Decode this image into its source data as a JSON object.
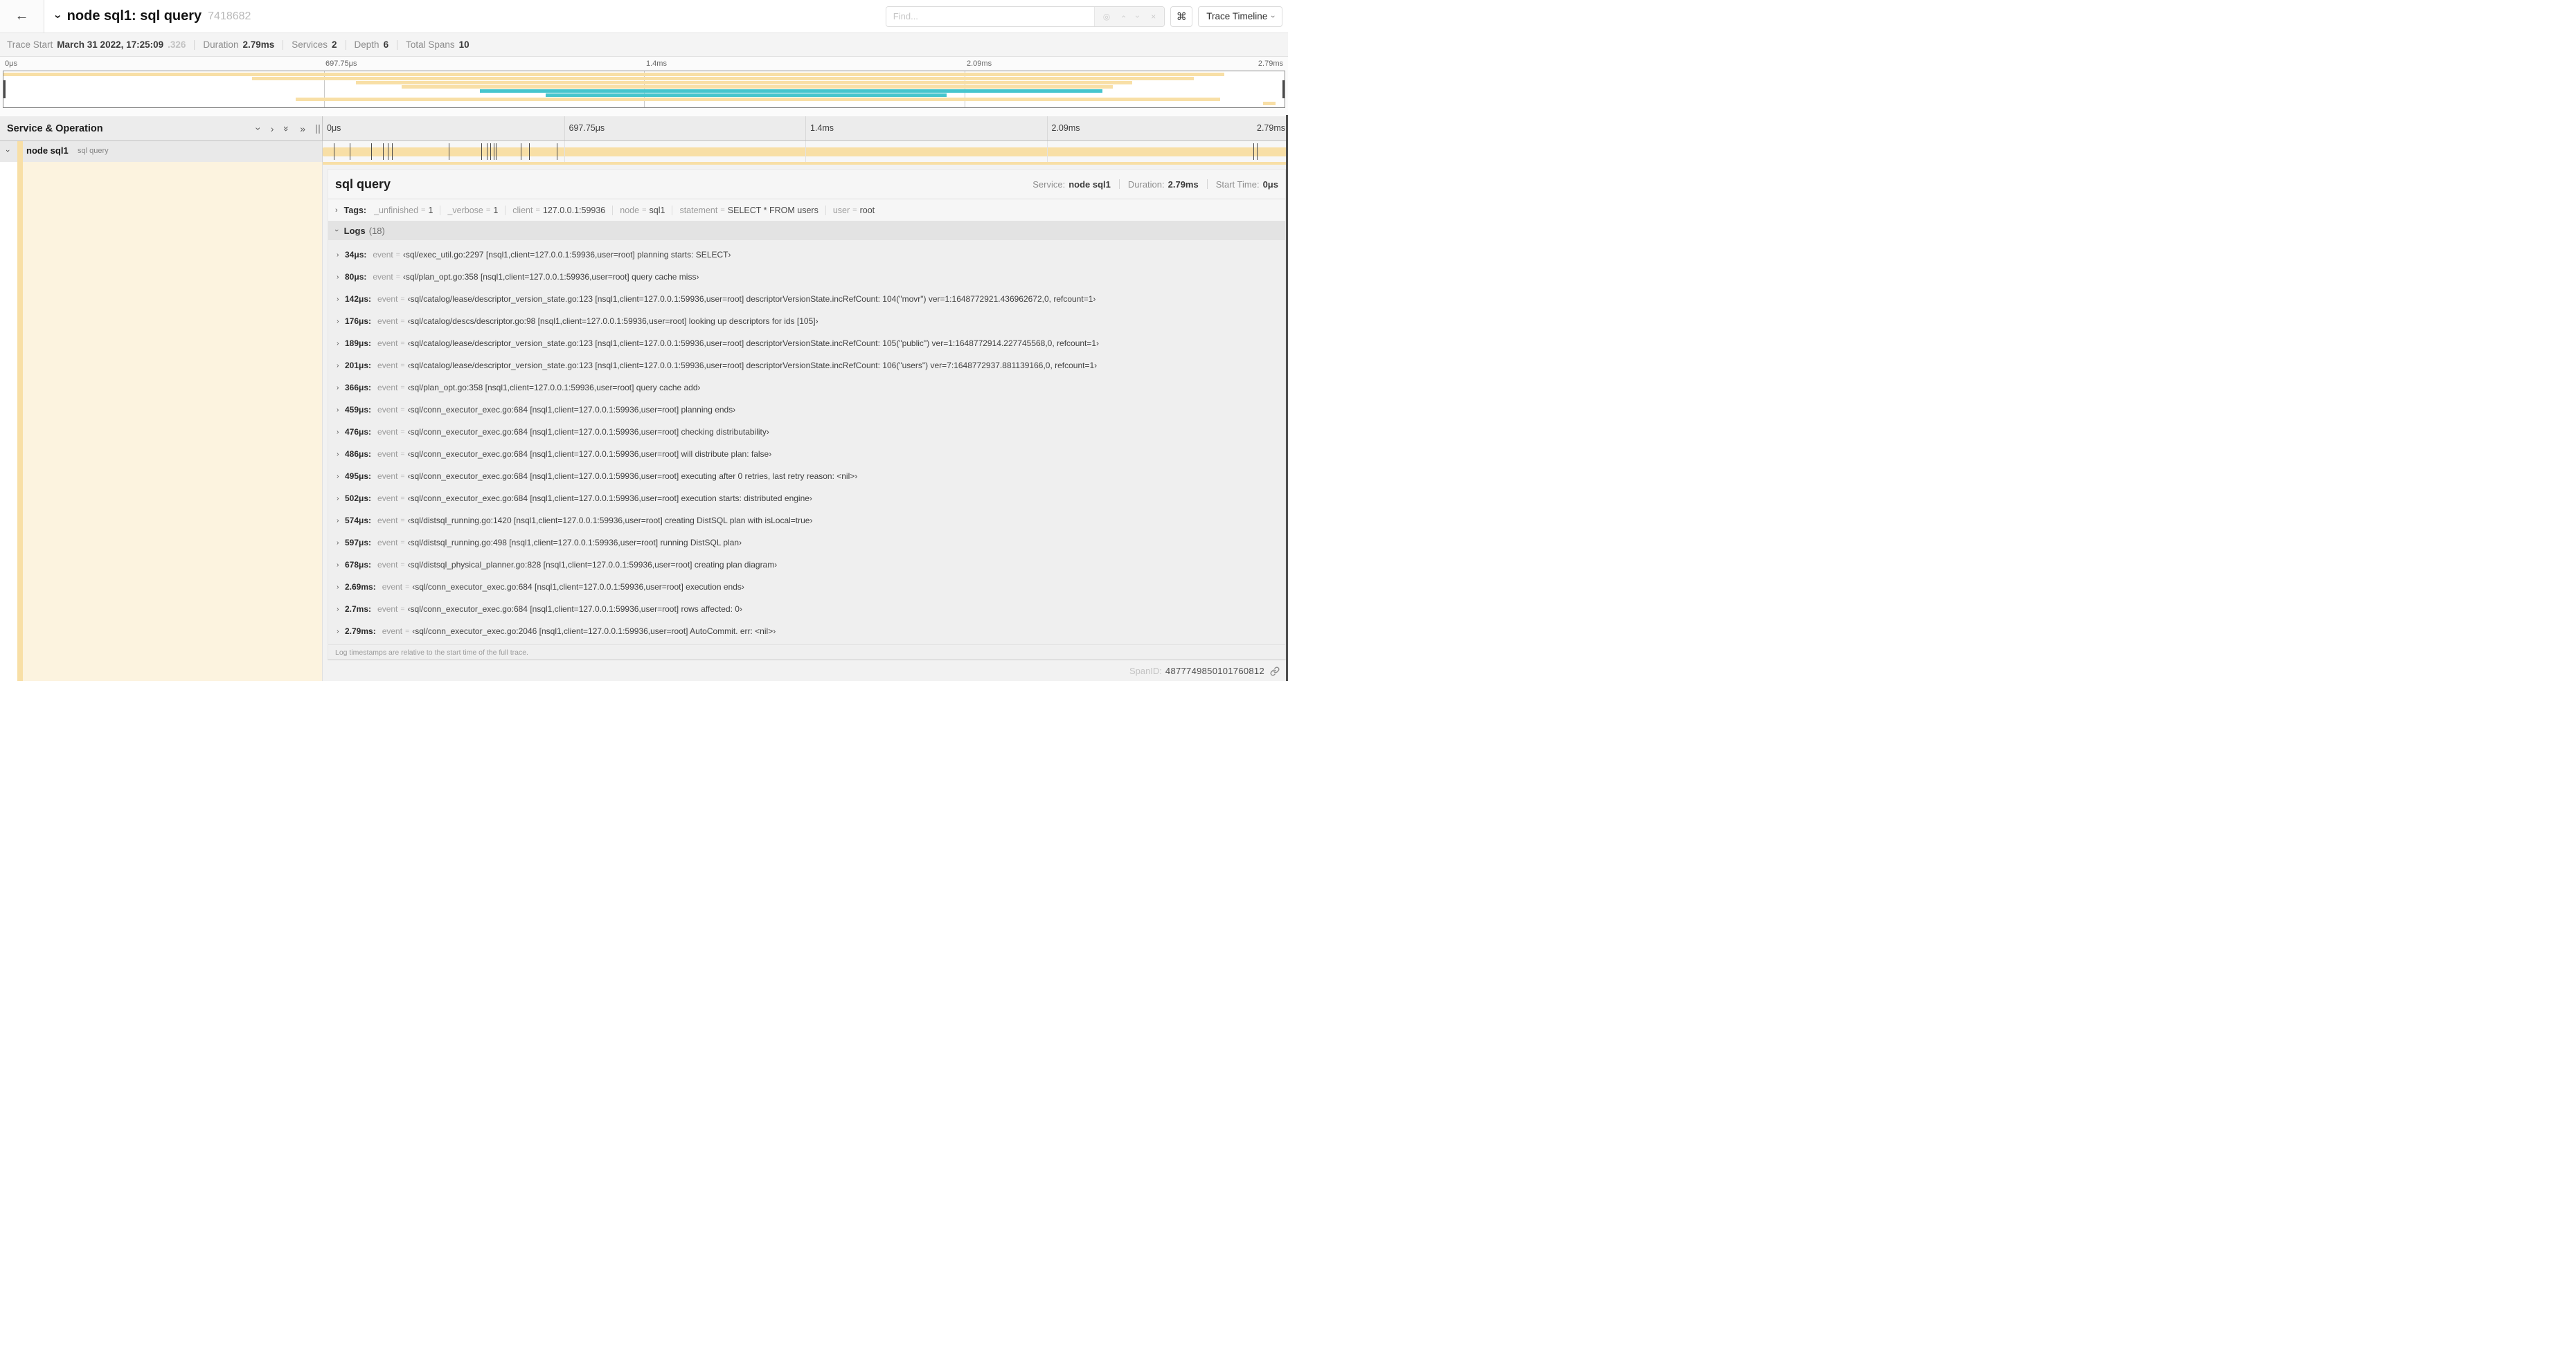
{
  "colors": {
    "span_bar": "#F8DFA6",
    "flow_bar": "#45C5CD"
  },
  "icons": {
    "back": "←",
    "chevron": "›",
    "double_chevron": "»",
    "locate": "◎",
    "up_chevron": "›",
    "down_chevron": "›",
    "clear": "×",
    "command": "⌘"
  },
  "header": {
    "title": "node sql1: sql query",
    "trace_id_short": "7418682",
    "find_placeholder": "Find...",
    "view_button": "Trace Timeline"
  },
  "summary": [
    {
      "label": "Trace Start",
      "value": "March 31 2022, 17:25:09",
      "suffix": ".326"
    },
    {
      "label": "Duration",
      "value": "2.79ms"
    },
    {
      "label": "Services",
      "value": "2"
    },
    {
      "label": "Depth",
      "value": "6"
    },
    {
      "label": "Total Spans",
      "value": "10"
    }
  ],
  "timeline": {
    "labels": [
      "0μs",
      "697.75μs",
      "1.4ms",
      "2.09ms",
      "2.79ms"
    ],
    "duration_us": 2790
  },
  "minimap": {
    "bars": [
      {
        "color": "span",
        "start_pct": 0.0,
        "end_pct": 95.3
      },
      {
        "color": "span",
        "start_pct": 19.4,
        "end_pct": 92.9
      },
      {
        "color": "span",
        "start_pct": 27.5,
        "end_pct": 88.1
      },
      {
        "color": "span",
        "start_pct": 31.1,
        "end_pct": 86.6
      },
      {
        "color": "flow",
        "start_pct": 37.2,
        "end_pct": 85.8
      },
      {
        "color": "flow",
        "start_pct": 42.3,
        "end_pct": 73.6
      },
      {
        "color": "span",
        "start_pct": 22.8,
        "end_pct": 95.0
      },
      {
        "color": "span",
        "start_pct": 98.3,
        "end_pct": 99.3
      }
    ]
  },
  "sidebar": {
    "header_title": "Service & Operation",
    "row": {
      "service": "node sql1",
      "operation": "sql query"
    }
  },
  "span_row": {
    "tick_times_us": [
      34,
      80,
      142,
      176,
      189,
      201,
      366,
      459,
      476,
      486,
      495,
      502,
      574,
      597,
      678,
      2690,
      2700,
      2790
    ]
  },
  "detail": {
    "title": "sql query",
    "service_label": "Service:",
    "service": "node sql1",
    "duration_label": "Duration:",
    "duration": "2.79ms",
    "start_label": "Start Time:",
    "start": "0μs",
    "tags_label": "Tags:",
    "tags": [
      {
        "key": "_unfinished",
        "value": "1"
      },
      {
        "key": "_verbose",
        "value": "1"
      },
      {
        "key": "client",
        "value": "127.0.0.1:59936"
      },
      {
        "key": "node",
        "value": "sql1"
      },
      {
        "key": "statement",
        "value": "SELECT * FROM users"
      },
      {
        "key": "user",
        "value": "root"
      }
    ],
    "logs_label": "Logs",
    "logs_count": "(18)",
    "event_key": "event",
    "logs": [
      {
        "t": "34μs:",
        "t_us": 34,
        "value": "‹sql/exec_util.go:2297 [nsql1,client=127.0.0.1:59936,user=root] planning starts: SELECT›"
      },
      {
        "t": "80μs:",
        "t_us": 80,
        "value": "‹sql/plan_opt.go:358 [nsql1,client=127.0.0.1:59936,user=root] query cache miss›"
      },
      {
        "t": "142μs:",
        "t_us": 142,
        "value": "‹sql/catalog/lease/descriptor_version_state.go:123 [nsql1,client=127.0.0.1:59936,user=root] descriptorVersionState.incRefCount: 104(\"movr\") ver=1:1648772921.436962672,0, refcount=1›"
      },
      {
        "t": "176μs:",
        "t_us": 176,
        "value": "‹sql/catalog/descs/descriptor.go:98 [nsql1,client=127.0.0.1:59936,user=root] looking up descriptors for ids [105]›"
      },
      {
        "t": "189μs:",
        "t_us": 189,
        "value": "‹sql/catalog/lease/descriptor_version_state.go:123 [nsql1,client=127.0.0.1:59936,user=root] descriptorVersionState.incRefCount: 105(\"public\") ver=1:1648772914.227745568,0, refcount=1›"
      },
      {
        "t": "201μs:",
        "t_us": 201,
        "value": "‹sql/catalog/lease/descriptor_version_state.go:123 [nsql1,client=127.0.0.1:59936,user=root] descriptorVersionState.incRefCount: 106(\"users\") ver=7:1648772937.881139166,0, refcount=1›"
      },
      {
        "t": "366μs:",
        "t_us": 366,
        "value": "‹sql/plan_opt.go:358 [nsql1,client=127.0.0.1:59936,user=root] query cache add›"
      },
      {
        "t": "459μs:",
        "t_us": 459,
        "value": "‹sql/conn_executor_exec.go:684 [nsql1,client=127.0.0.1:59936,user=root] planning ends›"
      },
      {
        "t": "476μs:",
        "t_us": 476,
        "value": "‹sql/conn_executor_exec.go:684 [nsql1,client=127.0.0.1:59936,user=root] checking distributability›"
      },
      {
        "t": "486μs:",
        "t_us": 486,
        "value": "‹sql/conn_executor_exec.go:684 [nsql1,client=127.0.0.1:59936,user=root] will distribute plan: false›"
      },
      {
        "t": "495μs:",
        "t_us": 495,
        "value": "‹sql/conn_executor_exec.go:684 [nsql1,client=127.0.0.1:59936,user=root] executing after 0 retries, last retry reason: <nil>›"
      },
      {
        "t": "502μs:",
        "t_us": 502,
        "value": "‹sql/conn_executor_exec.go:684 [nsql1,client=127.0.0.1:59936,user=root] execution starts: distributed engine›"
      },
      {
        "t": "574μs:",
        "t_us": 574,
        "value": "‹sql/distsql_running.go:1420 [nsql1,client=127.0.0.1:59936,user=root] creating DistSQL plan with isLocal=true›"
      },
      {
        "t": "597μs:",
        "t_us": 597,
        "value": "‹sql/distsql_running.go:498 [nsql1,client=127.0.0.1:59936,user=root] running DistSQL plan›"
      },
      {
        "t": "678μs:",
        "t_us": 678,
        "value": "‹sql/distsql_physical_planner.go:828 [nsql1,client=127.0.0.1:59936,user=root] creating plan diagram›"
      },
      {
        "t": "2.69ms:",
        "t_us": 2690,
        "value": "‹sql/conn_executor_exec.go:684 [nsql1,client=127.0.0.1:59936,user=root] execution ends›"
      },
      {
        "t": "2.7ms:",
        "t_us": 2700,
        "value": "‹sql/conn_executor_exec.go:684 [nsql1,client=127.0.0.1:59936,user=root] rows affected: 0›"
      },
      {
        "t": "2.79ms:",
        "t_us": 2790,
        "value": "‹sql/conn_executor_exec.go:2046 [nsql1,client=127.0.0.1:59936,user=root] AutoCommit. err: <nil>›"
      }
    ],
    "footer_note": "Log timestamps are relative to the start time of the full trace.",
    "span_id_label": "SpanID:",
    "span_id": "4877749850101760812"
  }
}
